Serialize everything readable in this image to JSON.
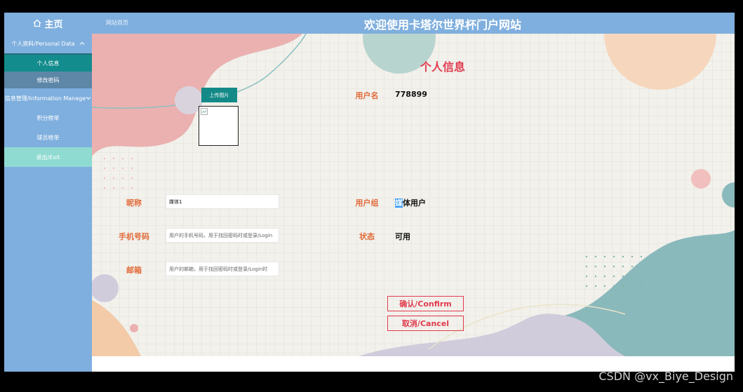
{
  "topbar": {
    "home_label": "主页",
    "site_home": "网站首页",
    "title": "欢迎使用卡塔尔世界杯门户网站"
  },
  "sidebar": {
    "group_personal": "个人资料/Personal Data",
    "item_profile": "个人信息",
    "item_password": "修改密码",
    "group_info": "信息管理/Information Manage",
    "item_points": "积分榜单",
    "item_shooter": "球员榜单",
    "item_exit": "退出/Exit"
  },
  "profile": {
    "title": "个人信息",
    "upload_label": "上传图片",
    "username_label": "用户名",
    "username_value": "778899",
    "nickname_label": "昵称",
    "nickname_value": "媒体1",
    "group_label": "用户组",
    "group_value_highlight": "媒",
    "group_value_rest": "体用户",
    "phone_label": "手机号码",
    "phone_placeholder": "用户的手机号码，用于找回密码时或登录/Login",
    "status_label": "状态",
    "status_value": "可用",
    "email_label": "邮箱",
    "email_placeholder": "用户的邮箱，用于找回密码时或登录/Login时",
    "confirm_label": "确认/Confirm",
    "cancel_label": "取消/Cancel"
  },
  "watermark": "CSDN @vx_Biye_Design",
  "colors": {
    "accent_blue": "#7fafde",
    "teal": "#148a88",
    "title_red": "#e23b4e",
    "label_orange": "#e26a3a"
  }
}
